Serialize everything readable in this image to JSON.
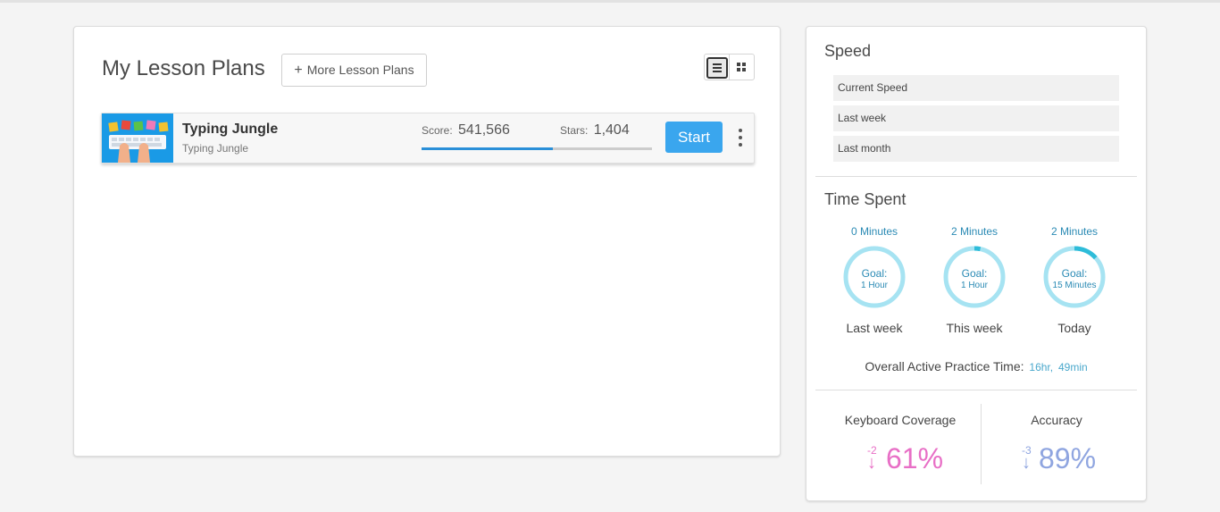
{
  "lesson_plans": {
    "title": "My Lesson Plans",
    "more_button": "More Lesson Plans",
    "more_button_icon": "plus-icon",
    "plans": [
      {
        "name": "Typing Jungle",
        "subtitle": "Typing Jungle",
        "score_label": "Score:",
        "score": "541,566",
        "stars_label": "Stars:",
        "stars": "1,404",
        "progress_fraction": 0.57,
        "start_label": "Start"
      }
    ]
  },
  "speed": {
    "title": "Speed",
    "rows": [
      "Current Speed",
      "Last week",
      "Last month"
    ]
  },
  "time_spent": {
    "title": "Time Spent",
    "rings": [
      {
        "minutes": "0 Minutes",
        "goal_label": "Goal:",
        "goal": "1 Hour",
        "label": "Last week",
        "progress_fraction": 0.0
      },
      {
        "minutes": "2 Minutes",
        "goal_label": "Goal:",
        "goal": "1 Hour",
        "label": "This week",
        "progress_fraction": 0.033
      },
      {
        "minutes": "2 Minutes",
        "goal_label": "Goal:",
        "goal": "15 Minutes",
        "label": "Today",
        "progress_fraction": 0.133
      }
    ],
    "overall_label": "Overall Active Practice Time:",
    "overall_hr": "16hr,",
    "overall_min": "49min"
  },
  "keyboard_coverage": {
    "title": "Keyboard Coverage",
    "delta": "-2",
    "value": "61%",
    "color": "#e86fc6"
  },
  "accuracy": {
    "title": "Accuracy",
    "delta": "-3",
    "value": "89%",
    "color": "#8fa5e0"
  },
  "colors": {
    "accent": "#3aa6ee",
    "ring_track": "#a6e3f2",
    "ring_fill": "#2ebcd9",
    "progress": "#2a8fd8"
  }
}
